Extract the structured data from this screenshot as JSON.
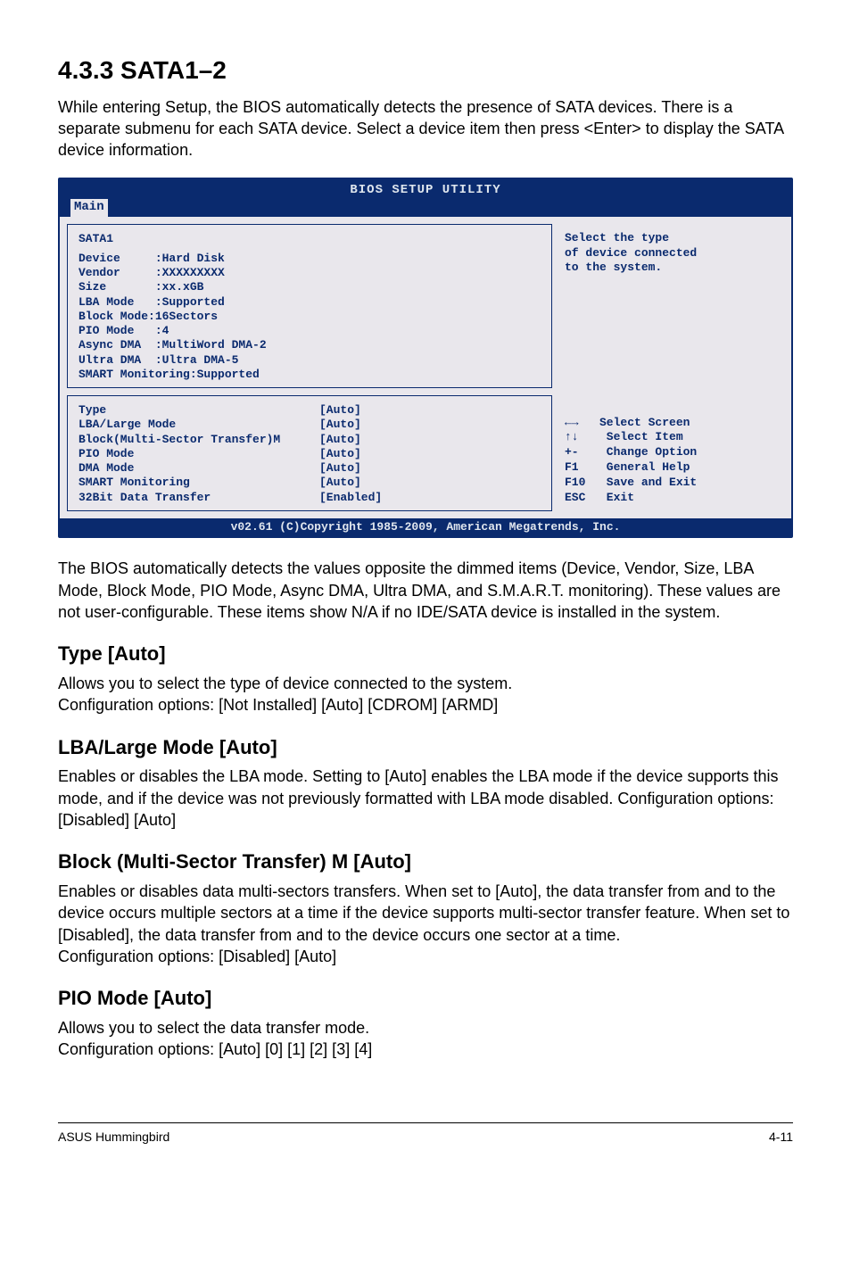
{
  "section": {
    "heading": "4.3.3    SATA1–2",
    "intro": "While entering Setup, the BIOS automatically detects the presence of SATA devices. There is a separate submenu for each SATA device. Select a device item then press <Enter> to display the SATA device information."
  },
  "bios": {
    "title": "BIOS SETUP UTILITY",
    "tab": "Main",
    "info_header": "SATA1",
    "info_rows": [
      "Device     :Hard Disk",
      "Vendor     :XXXXXXXXX",
      "Size       :xx.xGB",
      "LBA Mode   :Supported",
      "Block Mode:16Sectors",
      "PIO Mode   :4",
      "Async DMA  :MultiWord DMA-2",
      "Ultra DMA  :Ultra DMA-5",
      "SMART Monitoring:Supported"
    ],
    "settings": [
      {
        "label": "Type",
        "value": "[Auto]"
      },
      {
        "label": "LBA/Large Mode",
        "value": "[Auto]"
      },
      {
        "label": "Block(Multi-Sector Transfer)M",
        "value": "[Auto]"
      },
      {
        "label": "PIO Mode",
        "value": "[Auto]"
      },
      {
        "label": "DMA Mode",
        "value": "[Auto]"
      },
      {
        "label": "SMART Monitoring",
        "value": "[Auto]"
      },
      {
        "label": "32Bit Data Transfer",
        "value": "[Enabled]"
      }
    ],
    "help_top": "Select the type\nof device connected\nto the system.",
    "help_keys": "←→   Select Screen\n↑↓    Select Item\n+-    Change Option\nF1    General Help\nF10   Save and Exit\nESC   Exit",
    "footer": "v02.61 (C)Copyright 1985-2009, American Megatrends, Inc."
  },
  "post_bios": "The BIOS automatically detects the values opposite the dimmed items (Device, Vendor, Size, LBA Mode, Block Mode, PIO Mode, Async DMA, Ultra DMA, and S.M.A.R.T. monitoring). These values are not user-configurable. These items show N/A if no IDE/SATA device is installed in the system.",
  "type": {
    "heading": "Type [Auto]",
    "body1": "Allows you to select the type of device connected to the system.",
    "body2": "Configuration options: [Not Installed] [Auto] [CDROM] [ARMD]"
  },
  "lba": {
    "heading": "LBA/Large Mode [Auto]",
    "body": "Enables or disables the LBA mode. Setting to [Auto] enables the LBA mode if the device supports this mode, and if the device was not previously formatted with LBA mode disabled. Configuration options: [Disabled] [Auto]"
  },
  "block": {
    "heading": "Block (Multi-Sector Transfer) M [Auto]",
    "body1": "Enables or disables data multi-sectors transfers. When set to [Auto], the data transfer from and to the device occurs multiple sectors at a time if the device supports multi-sector transfer feature. When set to [Disabled], the data transfer from and to the device occurs one sector at a time.",
    "body2": "Configuration options: [Disabled] [Auto]"
  },
  "pio": {
    "heading": "PIO Mode [Auto]",
    "body1": "Allows you to select the data transfer mode.",
    "body2": "Configuration options: [Auto] [0] [1] [2] [3] [4]"
  },
  "footer": {
    "left": "ASUS Hummingbird",
    "right": "4-11"
  }
}
